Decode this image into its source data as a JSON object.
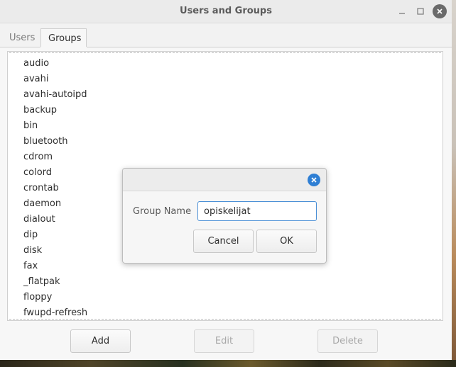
{
  "window": {
    "title": "Users and Groups"
  },
  "tabs": [
    {
      "label": "Users",
      "selected": false
    },
    {
      "label": "Groups",
      "selected": true
    }
  ],
  "groups": [
    "audio",
    "avahi",
    "avahi-autoipd",
    "backup",
    "bin",
    "bluetooth",
    "cdrom",
    "colord",
    "crontab",
    "daemon",
    "dialout",
    "dip",
    "disk",
    "fax",
    "_flatpak",
    "floppy",
    "fwupd-refresh"
  ],
  "actions": {
    "add_label": "Add",
    "edit_label": "Edit",
    "edit_enabled": false,
    "delete_label": "Delete",
    "delete_enabled": false
  },
  "dialog": {
    "field_label": "Group Name",
    "field_value": "opiskelijat",
    "cancel_label": "Cancel",
    "ok_label": "OK"
  },
  "icons": {
    "minimize": "minimize-icon",
    "maximize": "maximize-icon",
    "close": "close-icon",
    "dialog_close": "close-icon"
  },
  "colors": {
    "accent": "#2f7fd4",
    "window_close": "#6a6a6a"
  }
}
